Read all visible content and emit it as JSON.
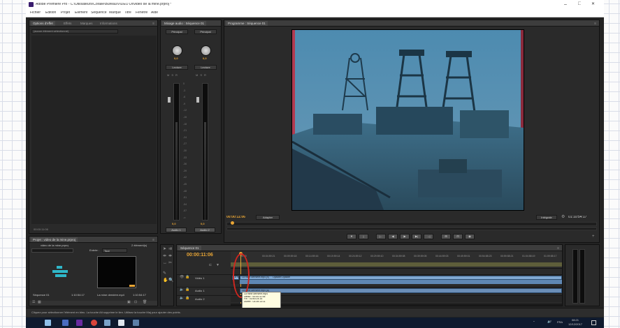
{
  "window": {
    "title": "Adobe Premiere Pro - C:\\Utilisateurs\\Coralie\\Bureau\\VIDEO Dt\\video de la mine.prproj *",
    "controls": {
      "minimize": "–",
      "maximize": "□",
      "close": "✕"
    }
  },
  "menu": [
    "Fichier",
    "Edition",
    "Projet",
    "Élément",
    "Séquence",
    "Marque",
    "Titre",
    "Fenêtre",
    "Aide"
  ],
  "effects_panel": {
    "tabs": [
      "Options d'effet",
      "Effets",
      "Marques",
      "Informations"
    ],
    "message": "(aucun élément sélectionné)",
    "timecode": "00:00:11:06"
  },
  "mixer_panel": {
    "tab": "Mixage audio : Séquence 01",
    "tracks": [
      {
        "name": "Audio 1",
        "routing": "Principal",
        "mode": "Lecture",
        "value": "0,0",
        "level": 0.72
      },
      {
        "name": "Audio 2",
        "routing": "Principal",
        "mode": "Lecture",
        "value": "0,0",
        "level": 0.72
      }
    ],
    "scale": [
      "0",
      "-3",
      "-6",
      "-9",
      "-12",
      "-15",
      "-18",
      "-21",
      "-24",
      "-27",
      "-30",
      "-33",
      "-36",
      "-39",
      "-42",
      "-45",
      "-48",
      "-51",
      "-54",
      "-57",
      "-∞"
    ],
    "transport_time": "00:00:11:06"
  },
  "program_monitor": {
    "tab": "Programme : Séquence 01",
    "current_time": "00:00:11:06",
    "fit": "Adapter",
    "resolution": "Intégrale",
    "duration": "01:10:54:17",
    "playhead": 0.1
  },
  "project_panel": {
    "tab": "Projet : video de la mine.prproj",
    "project_file": "video de la mine.prproj",
    "item_count": "2 élément(s)",
    "entree_label": "Entrée :",
    "entree_value": "Tout",
    "search_placeholder": "",
    "items": [
      {
        "name": "Séquence 01",
        "duration": "1:10:54:17"
      },
      {
        "name": "La mine dernière.mp4",
        "duration": "1:10:54:17"
      }
    ]
  },
  "timeline": {
    "tab": "Séquence 01",
    "timecode": "00:00:11:06",
    "ruler": [
      "00:00",
      "00:04:59:21",
      "00:09:59:18",
      "00:14:59:16",
      "00:19:59:14",
      "00:24:59:12",
      "00:29:59:10",
      "00:34:59:08",
      "00:39:59:05",
      "00:44:59:03",
      "00:49:59:01",
      "00:54:58:23",
      "00:59:58:21",
      "01:04:58:19",
      "01:09:58:17"
    ],
    "tracks": [
      {
        "name": "Vidéo 1",
        "kind": "video"
      },
      {
        "name": "Audio 1",
        "kind": "audio"
      },
      {
        "name": "Audio 2",
        "kind": "audio"
      }
    ],
    "clips_video": [
      "La mine",
      "La mine dernière.mp4 [V]",
      "Opacité:Opacité"
    ],
    "clips_audio": [
      "La mine dernière.mp4 [A]"
    ],
    "tooltip": {
      "name": "La mine dernière.mp4",
      "start": "Début : 00:00:11:06",
      "end": "Fin : 03:50:24:16",
      "duration": "Durée : 03:39:13:11"
    }
  },
  "status": "Cliquez pour sélectionner l'élément en bleu. La touche Alt supprime le lien. Utilisez la touche Maj pour ajouter des points.",
  "taskbar": {
    "tray": [
      "^",
      "🔊",
      "FRA"
    ],
    "time": "08:21",
    "date": "12/12/2017"
  },
  "colors": {
    "accent": "#e8a535",
    "video_clip": "#7fa7d1",
    "audio_clip": "#6b8fb8",
    "panel_bg": "#2a2a2a",
    "annotation": "#d0261f"
  }
}
